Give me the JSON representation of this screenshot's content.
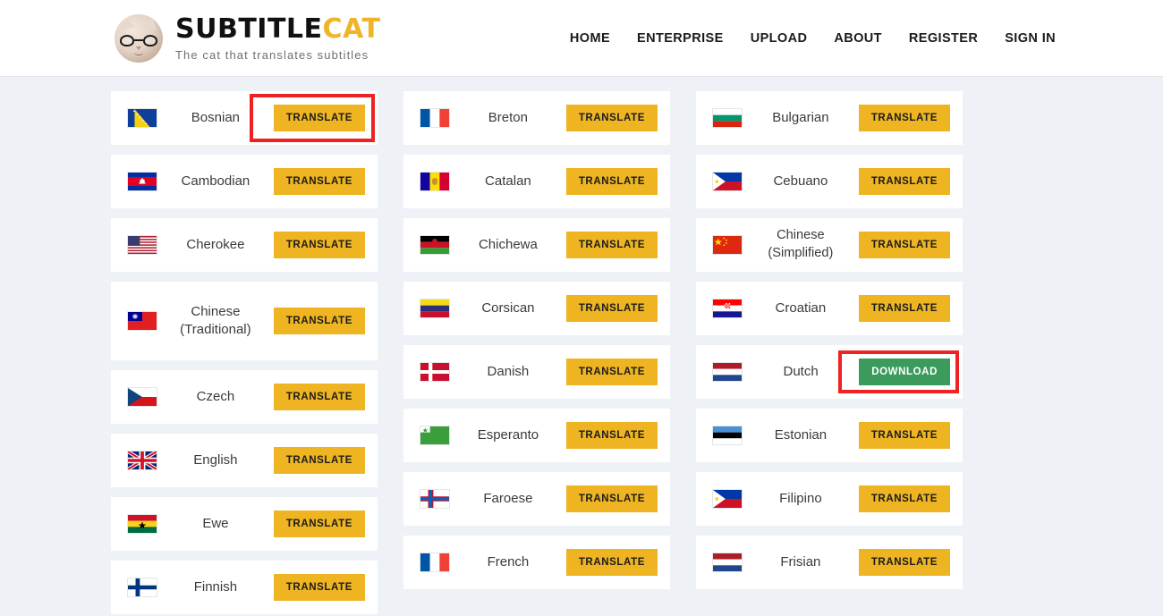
{
  "header": {
    "logo": {
      "avatar_alt": "cat-avatar",
      "word_primary": "SUBTITLE",
      "word_accent": "CAT",
      "tagline": "The cat that translates subtitles"
    },
    "nav": [
      {
        "label": "HOME"
      },
      {
        "label": "ENTERPRISE"
      },
      {
        "label": "UPLOAD"
      },
      {
        "label": "ABOUT"
      },
      {
        "label": "REGISTER"
      },
      {
        "label": "SIGN IN"
      }
    ]
  },
  "labels": {
    "translate": "TRANSLATE",
    "download": "DOWNLOAD"
  },
  "colors": {
    "accent_yellow": "#eeb422",
    "accent_green": "#3a9b5c",
    "logo_accent": "#f0b429",
    "page_background": "#eef1f5",
    "card_background": "#ffffff",
    "highlight_red": "#ee2222"
  },
  "columns": [
    {
      "rows": [
        {
          "name": "Bosnian",
          "flag": "bosnia-flag",
          "action": "TRANSLATE",
          "highlighted": true,
          "tall": false
        },
        {
          "name": "Cambodian",
          "flag": "cambodia-flag",
          "action": "TRANSLATE",
          "highlighted": false,
          "tall": false
        },
        {
          "name": "Cherokee",
          "flag": "united-states-flag",
          "action": "TRANSLATE",
          "highlighted": false,
          "tall": false
        },
        {
          "name": "Chinese (Traditional)",
          "flag": "taiwan-flag",
          "action": "TRANSLATE",
          "highlighted": false,
          "tall": true
        },
        {
          "name": "Czech",
          "flag": "czech-republic-flag",
          "action": "TRANSLATE",
          "highlighted": false,
          "tall": false
        },
        {
          "name": "English",
          "flag": "united-kingdom-flag",
          "action": "TRANSLATE",
          "highlighted": false,
          "tall": false
        },
        {
          "name": "Ewe",
          "flag": "ghana-flag",
          "action": "TRANSLATE",
          "highlighted": false,
          "tall": false
        },
        {
          "name": "Finnish",
          "flag": "finland-flag",
          "action": "TRANSLATE",
          "highlighted": false,
          "tall": false
        }
      ]
    },
    {
      "rows": [
        {
          "name": "Breton",
          "flag": "france-flag",
          "action": "TRANSLATE",
          "highlighted": false,
          "tall": false
        },
        {
          "name": "Catalan",
          "flag": "andorra-flag",
          "action": "TRANSLATE",
          "highlighted": false,
          "tall": false
        },
        {
          "name": "Chichewa",
          "flag": "malawi-flag",
          "action": "TRANSLATE",
          "highlighted": false,
          "tall": false
        },
        {
          "name": "Corsican",
          "flag": "corsica-flag",
          "action": "TRANSLATE",
          "highlighted": false,
          "tall": false
        },
        {
          "name": "Danish",
          "flag": "denmark-flag",
          "action": "TRANSLATE",
          "highlighted": false,
          "tall": false
        },
        {
          "name": "Esperanto",
          "flag": "esperanto-flag",
          "action": "TRANSLATE",
          "highlighted": false,
          "tall": false
        },
        {
          "name": "Faroese",
          "flag": "faroe-flag",
          "action": "TRANSLATE",
          "highlighted": false,
          "tall": false
        },
        {
          "name": "French",
          "flag": "france-flag",
          "action": "TRANSLATE",
          "highlighted": false,
          "tall": false
        }
      ]
    },
    {
      "rows": [
        {
          "name": "Bulgarian",
          "flag": "bulgaria-flag",
          "action": "TRANSLATE",
          "highlighted": false,
          "tall": false
        },
        {
          "name": "Cebuano",
          "flag": "philippines-flag",
          "action": "TRANSLATE",
          "highlighted": false,
          "tall": false
        },
        {
          "name": "Chinese (Simplified)",
          "flag": "china-flag",
          "action": "TRANSLATE",
          "highlighted": false,
          "tall": false
        },
        {
          "name": "Croatian",
          "flag": "croatia-flag",
          "action": "TRANSLATE",
          "highlighted": false,
          "tall": false
        },
        {
          "name": "Dutch",
          "flag": "netherlands-flag",
          "action": "DOWNLOAD",
          "highlighted": true,
          "tall": false
        },
        {
          "name": "Estonian",
          "flag": "estonia-flag",
          "action": "TRANSLATE",
          "highlighted": false,
          "tall": false
        },
        {
          "name": "Filipino",
          "flag": "philippines-flag",
          "action": "TRANSLATE",
          "highlighted": false,
          "tall": false
        },
        {
          "name": "Frisian",
          "flag": "frisia-flag",
          "action": "TRANSLATE",
          "highlighted": false,
          "tall": false
        }
      ]
    }
  ]
}
